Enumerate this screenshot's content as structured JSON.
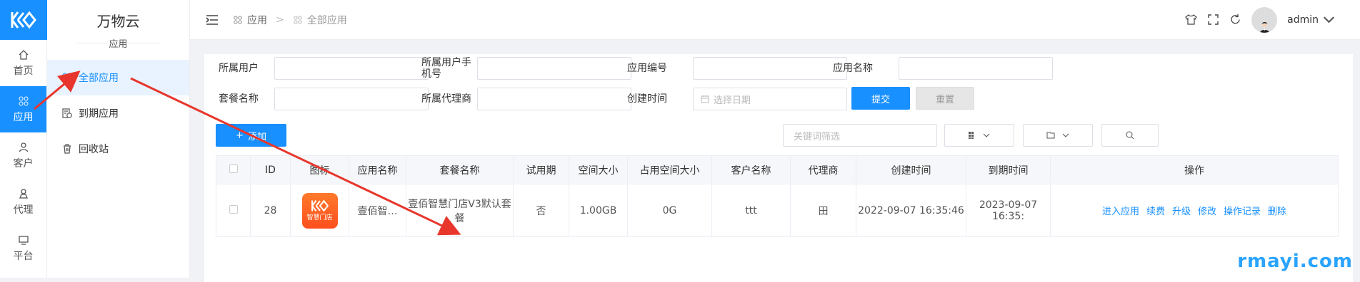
{
  "rail": {
    "items": [
      {
        "label": "首页",
        "icon": "home-icon"
      },
      {
        "label": "应用",
        "icon": "apps-icon",
        "active": true
      },
      {
        "label": "客户",
        "icon": "user-icon"
      },
      {
        "label": "代理",
        "icon": "agent-icon"
      },
      {
        "label": "平台",
        "icon": "monitor-icon"
      }
    ]
  },
  "sidebar": {
    "brand": "万物云",
    "subtitle": "应用",
    "items": [
      {
        "label": "全部应用",
        "icon": "apps-icon",
        "active": true
      },
      {
        "label": "到期应用",
        "icon": "expiry-icon"
      },
      {
        "label": "回收站",
        "icon": "trash-icon"
      }
    ]
  },
  "header": {
    "breadcrumb": [
      "应用",
      "全部应用"
    ],
    "username": "admin"
  },
  "form": {
    "owner_label": "所属用户",
    "owner_phone_label": "所属用户手机号",
    "app_no_label": "应用编号",
    "app_name_label": "应用名称",
    "package_label": "套餐名称",
    "agent_label": "所属代理商",
    "created_label": "创建时间",
    "date_placeholder": "选择日期",
    "submit": "提交",
    "reset": "重置"
  },
  "toolbar": {
    "add": "添加",
    "keyword_placeholder": "关键词筛选"
  },
  "table": {
    "columns": [
      "ID",
      "图标",
      "应用名称",
      "套餐名称",
      "试用期",
      "空间大小",
      "占用空间大小",
      "客户名称",
      "代理商",
      "创建时间",
      "到期时间",
      "操作"
    ],
    "rows": [
      {
        "id": "28",
        "icon_text": "智慧门店",
        "app_name": "壹佰智…",
        "package": "壹佰智慧门店V3默认套餐",
        "trial": "否",
        "space": "1.00GB",
        "used": "0G",
        "customer": "ttt",
        "agent": "田",
        "created": "2022-09-07 16:35:46",
        "expires": "2023-09-07 16:35:",
        "ops": [
          "进入应用",
          "续费",
          "升级",
          "修改",
          "操作记录",
          "删除"
        ]
      }
    ]
  },
  "watermark": "rmayi.com",
  "colors": {
    "primary": "#1890ff",
    "arrow": "#e8362c"
  }
}
